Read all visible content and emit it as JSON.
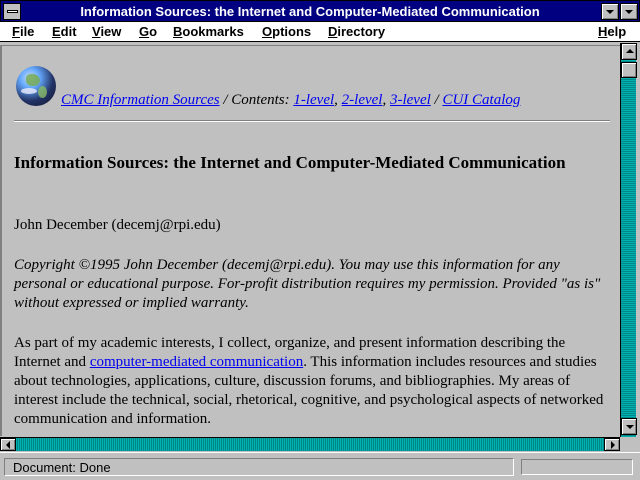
{
  "window": {
    "title": "Information Sources: the Internet and Computer-Mediated Communication"
  },
  "menubar": {
    "items": [
      {
        "underlined": "F",
        "rest": "ile"
      },
      {
        "underlined": "E",
        "rest": "dit"
      },
      {
        "underlined": "V",
        "rest": "iew"
      },
      {
        "underlined": "G",
        "rest": "o"
      },
      {
        "underlined": "B",
        "rest": "ookmarks"
      },
      {
        "underlined": "O",
        "rest": "ptions"
      },
      {
        "underlined": "D",
        "rest": "irectory"
      },
      {
        "underlined": "H",
        "rest": "elp"
      }
    ]
  },
  "nav": {
    "home_link": "CMC Information Sources",
    "sep1": " / Contents: ",
    "level1": "1-level",
    "comma1": ", ",
    "level2": "2-level",
    "comma2": ", ",
    "level3": "3-level",
    "sep2": " / ",
    "catalog_link": "CUI Catalog"
  },
  "page": {
    "heading": "Information Sources: the Internet and Computer-Mediated Communication",
    "author": "John December (decemj@rpi.edu)",
    "copyright": "Copyright ©1995 John December (decemj@rpi.edu). You may use this information for any personal or educational purpose. For-profit distribution requires my permission. Provided \"as is\" without expressed or implied warranty.",
    "intro_before": "As part of my academic interests, I collect, organize, and present information describing the Internet and ",
    "intro_link": "computer-mediated communication",
    "intro_after": ". This information includes resources and studies about technologies, applications, culture, discussion forums, and bibliographies. My areas of interest include the technical, social, rhetorical, cognitive, and psychological aspects of networked communication and information."
  },
  "status": {
    "text": "Document: Done"
  },
  "icons": {
    "globe": "globe-icon"
  },
  "colors": {
    "titlebar": "#000080",
    "link": "#0000ee",
    "scrollbar": "#00a0a0",
    "background": "#c0c0c0"
  }
}
